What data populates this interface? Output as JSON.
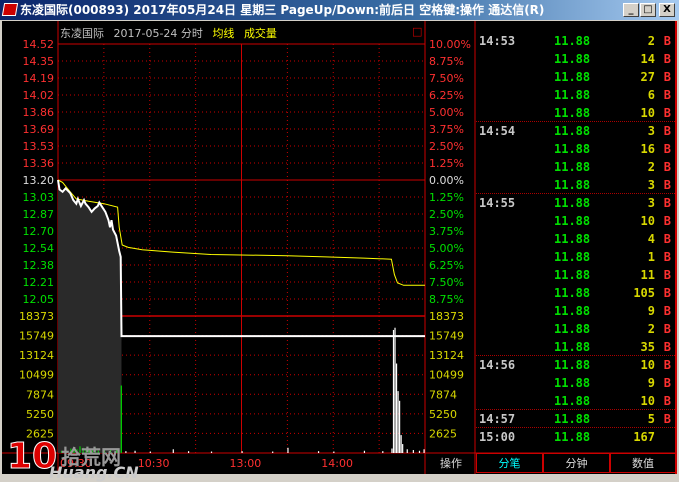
{
  "window": {
    "title": "东凌国际(000893) 2017年05月24日 星期三 PageUp/Down:前后日 空格键:操作 通达信(R)",
    "min": "_",
    "max": "□",
    "close": "X"
  },
  "header": {
    "name": "东凌国际",
    "date": "2017-05-24 分时",
    "avg_label": "均线",
    "vol_label": "成交量",
    "box": "□"
  },
  "colors": {
    "up": "#ff3030",
    "down": "#00e000",
    "grid": "#c00000",
    "price_line": "#ffffff",
    "avg_line": "#ffff00",
    "vol_label": "#d8d800"
  },
  "chart_data": {
    "type": "line",
    "title": "东凌国际 2017-05-24 分时",
    "prev_close": 13.2,
    "ylim": [
      11.88,
      14.52
    ],
    "price_ticks": [
      "14.52",
      "14.35",
      "14.19",
      "14.02",
      "13.86",
      "13.69",
      "13.53",
      "13.36",
      "13.20",
      "13.03",
      "12.87",
      "12.70",
      "12.54",
      "12.38",
      "12.21",
      "12.05"
    ],
    "pct_ticks": [
      "10.00%",
      "8.75%",
      "7.50%",
      "6.25%",
      "5.00%",
      "3.75%",
      "2.50%",
      "1.25%",
      "0.00%",
      "1.25%",
      "2.50%",
      "3.75%",
      "5.00%",
      "6.25%",
      "7.50%",
      "8.75%"
    ],
    "vol_ticks": [
      "18373",
      "15749",
      "13124",
      "10499",
      "7874",
      "5250",
      "2625"
    ],
    "vol_max": 18373,
    "time_labels": [
      "09:30",
      "10:30",
      "13:00",
      "14:00"
    ],
    "minutes": 240,
    "series": [
      {
        "name": "价格",
        "points": [
          [
            0,
            13.2
          ],
          [
            1,
            13.12
          ],
          [
            3,
            13.1
          ],
          [
            5,
            13.13
          ],
          [
            8,
            13.09
          ],
          [
            10,
            13.03
          ],
          [
            12,
            13.0
          ],
          [
            13,
            13.04
          ],
          [
            15,
            12.98
          ],
          [
            17,
            13.03
          ],
          [
            18,
            13.0
          ],
          [
            20,
            12.97
          ],
          [
            22,
            12.93
          ],
          [
            24,
            12.96
          ],
          [
            26,
            12.98
          ],
          [
            27,
            13.01
          ],
          [
            29,
            12.97
          ],
          [
            31,
            12.93
          ],
          [
            33,
            12.86
          ],
          [
            34,
            12.8
          ],
          [
            35,
            12.86
          ],
          [
            36,
            12.78
          ],
          [
            38,
            12.73
          ],
          [
            40,
            12.6
          ],
          [
            41,
            12.55
          ],
          [
            41.5,
            11.88
          ],
          [
            240,
            11.88
          ]
        ]
      },
      {
        "name": "均线",
        "points": [
          [
            0,
            13.2
          ],
          [
            3,
            13.18
          ],
          [
            8,
            13.1
          ],
          [
            12,
            13.04
          ],
          [
            20,
            13.02
          ],
          [
            30,
            13.0
          ],
          [
            39,
            12.97
          ],
          [
            40,
            12.8
          ],
          [
            42,
            12.65
          ],
          [
            46,
            12.63
          ],
          [
            55,
            12.61
          ],
          [
            75,
            12.59
          ],
          [
            100,
            12.57
          ],
          [
            150,
            12.56
          ],
          [
            175,
            12.55
          ],
          [
            200,
            12.54
          ],
          [
            218,
            12.53
          ],
          [
            220,
            12.4
          ],
          [
            222,
            12.33
          ],
          [
            226,
            12.31
          ],
          [
            240,
            12.31
          ]
        ]
      }
    ],
    "volume": [
      [
        2,
        300
      ],
      [
        5,
        250
      ],
      [
        8,
        600
      ],
      [
        10,
        800
      ],
      [
        12,
        500
      ],
      [
        14,
        900
      ],
      [
        16,
        700
      ],
      [
        18,
        400
      ],
      [
        20,
        600
      ],
      [
        22,
        500
      ],
      [
        24,
        700
      ],
      [
        26,
        300
      ],
      [
        30,
        400
      ],
      [
        34,
        500
      ],
      [
        38,
        600
      ],
      [
        41,
        9050
      ],
      [
        44,
        250
      ],
      [
        50,
        300
      ],
      [
        60,
        200
      ],
      [
        75,
        500
      ],
      [
        85,
        250
      ],
      [
        100,
        200
      ],
      [
        120,
        250
      ],
      [
        140,
        200
      ],
      [
        150,
        700
      ],
      [
        170,
        250
      ],
      [
        180,
        200
      ],
      [
        200,
        300
      ],
      [
        212,
        250
      ],
      [
        218,
        600
      ],
      [
        219,
        16500
      ],
      [
        220,
        16800
      ],
      [
        221,
        12000
      ],
      [
        222,
        8300
      ],
      [
        223,
        7000
      ],
      [
        224,
        2400
      ],
      [
        225,
        1200
      ],
      [
        228,
        500
      ],
      [
        232,
        400
      ],
      [
        236,
        300
      ],
      [
        239,
        500
      ]
    ]
  },
  "ticks": [
    {
      "time": "14:53",
      "price": "11.88",
      "vol": "2",
      "bs": "B"
    },
    {
      "time": "",
      "price": "11.88",
      "vol": "14",
      "bs": "B"
    },
    {
      "time": "",
      "price": "11.88",
      "vol": "27",
      "bs": "B"
    },
    {
      "time": "",
      "price": "11.88",
      "vol": "6",
      "bs": "B"
    },
    {
      "time": "",
      "price": "11.88",
      "vol": "10",
      "bs": "B"
    },
    {
      "time": "14:54",
      "price": "11.88",
      "vol": "3",
      "bs": "B"
    },
    {
      "time": "",
      "price": "11.88",
      "vol": "16",
      "bs": "B"
    },
    {
      "time": "",
      "price": "11.88",
      "vol": "2",
      "bs": "B"
    },
    {
      "time": "",
      "price": "11.88",
      "vol": "3",
      "bs": "B"
    },
    {
      "time": "14:55",
      "price": "11.88",
      "vol": "3",
      "bs": "B"
    },
    {
      "time": "",
      "price": "11.88",
      "vol": "10",
      "bs": "B"
    },
    {
      "time": "",
      "price": "11.88",
      "vol": "4",
      "bs": "B"
    },
    {
      "time": "",
      "price": "11.88",
      "vol": "1",
      "bs": "B"
    },
    {
      "time": "",
      "price": "11.88",
      "vol": "11",
      "bs": "B"
    },
    {
      "time": "",
      "price": "11.88",
      "vol": "105",
      "bs": "B"
    },
    {
      "time": "",
      "price": "11.88",
      "vol": "9",
      "bs": "B"
    },
    {
      "time": "",
      "price": "11.88",
      "vol": "2",
      "bs": "B"
    },
    {
      "time": "",
      "price": "11.88",
      "vol": "35",
      "bs": "B"
    },
    {
      "time": "14:56",
      "price": "11.88",
      "vol": "10",
      "bs": "B"
    },
    {
      "time": "",
      "price": "11.88",
      "vol": "9",
      "bs": "B"
    },
    {
      "time": "",
      "price": "11.88",
      "vol": "10",
      "bs": "B"
    },
    {
      "time": "14:57",
      "price": "11.88",
      "vol": "5",
      "bs": "B"
    },
    {
      "time": "15:00",
      "price": "11.88",
      "vol": "167",
      "bs": ""
    }
  ],
  "tabs": [
    "操作",
    "分笔",
    "分钟",
    "数值"
  ],
  "watermark": {
    "num": "10",
    "cn": "拾荒网",
    "en": "Huang.CN"
  }
}
